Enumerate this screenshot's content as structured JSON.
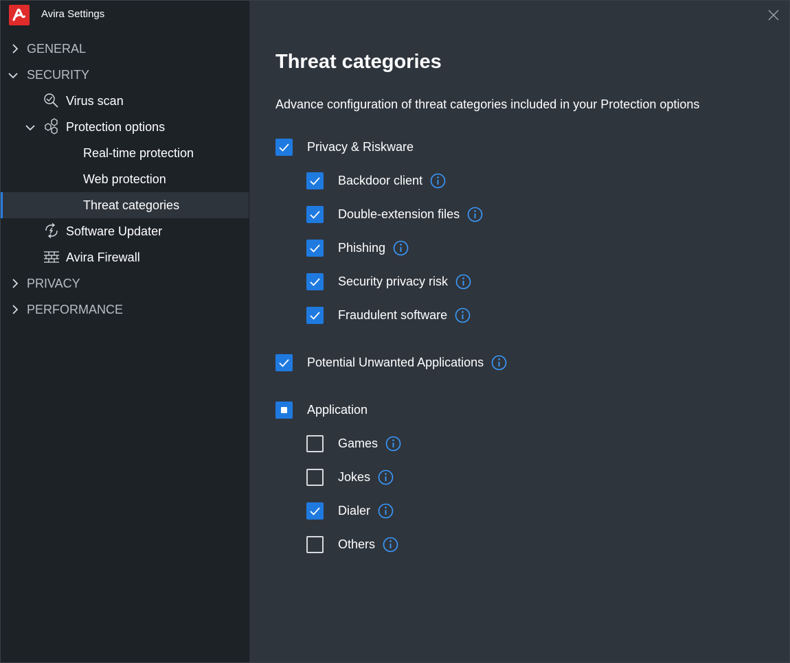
{
  "app": {
    "title": "Avira Settings",
    "brand_color": "#e02b2b",
    "accent_color": "#1f7ae0"
  },
  "sidebar": {
    "general": "GENERAL",
    "security": "SECURITY",
    "virus_scan": "Virus scan",
    "protection_options": "Protection options",
    "real_time_protection": "Real-time protection",
    "web_protection": "Web protection",
    "threat_categories": "Threat categories",
    "software_updater": "Software Updater",
    "avira_firewall": "Avira Firewall",
    "privacy": "PRIVACY",
    "performance": "PERFORMANCE"
  },
  "main": {
    "title": "Threat categories",
    "description": "Advance configuration of threat categories included in your Protection options",
    "groups": {
      "privacy_riskware": {
        "label": "Privacy & Riskware",
        "state": "checked"
      },
      "backdoor_client": {
        "label": "Backdoor client",
        "state": "checked"
      },
      "double_extension_files": {
        "label": "Double-extension files",
        "state": "checked"
      },
      "phishing": {
        "label": "Phishing",
        "state": "checked"
      },
      "security_privacy_risk": {
        "label": "Security privacy risk",
        "state": "checked"
      },
      "fraudulent_software": {
        "label": "Fraudulent software",
        "state": "checked"
      },
      "potential_unwanted_apps": {
        "label": "Potential Unwanted Applications",
        "state": "checked"
      },
      "application": {
        "label": "Application",
        "state": "mixed"
      },
      "games": {
        "label": "Games",
        "state": "unchecked"
      },
      "jokes": {
        "label": "Jokes",
        "state": "unchecked"
      },
      "dialer": {
        "label": "Dialer",
        "state": "checked"
      },
      "others": {
        "label": "Others",
        "state": "unchecked"
      }
    }
  },
  "icons": {
    "logo": "avira-logo-icon",
    "close": "close-icon",
    "chevron_right": "chevron-right-icon",
    "chevron_down": "chevron-down-icon",
    "virus_scan": "magnifier-scan-icon",
    "protection_options": "hexagon-cluster-icon",
    "software_updater": "refresh-arrows-icon",
    "firewall": "brick-wall-icon",
    "info": "info-icon"
  }
}
